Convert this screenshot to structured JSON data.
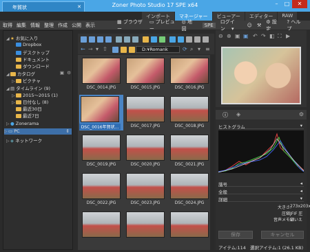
{
  "window": {
    "title": "Zoner Photo Studio 17 SPE x64",
    "doc_tab": "年賀状",
    "min_label": "–",
    "max_label": "□",
    "close_label": "✕"
  },
  "modules": [
    "インポート",
    "マネージャー",
    "ビューアー",
    "エディター",
    "RAW"
  ],
  "menu": [
    "取得",
    "編集",
    "情報",
    "整理",
    "作成",
    "公開",
    "表示"
  ],
  "menu_right": {
    "browser": "ブラウザー",
    "preview": "プレビュー",
    "map": "地図",
    "spe": "SPE",
    "login": "ログイン",
    "settings": "設定",
    "help": "ヘルプ"
  },
  "tree": {
    "favorites": "お気に入り",
    "dropbox": "Dropbox",
    "desktop": "デスクトップ",
    "documents": "ドキュメント",
    "downloads": "ダウンロード",
    "catalog": "カタログ",
    "pictures": "ピクチャ",
    "timeline": "タイムライン (9)",
    "t1": "2015～2015 (1)",
    "t2": "日付なし (8)",
    "t3": "最近30日",
    "t4": "最近7日",
    "zonerama": "Zonerama",
    "pc": "PC",
    "network": "ネットワーク"
  },
  "path": "D:¥Romank",
  "thumbs": [
    {
      "cap": "DSC_0014.JPG"
    },
    {
      "cap": "DSC_0015.JPG"
    },
    {
      "cap": "DSC_0016.JPG"
    },
    {
      "cap": "DSC_0016年賀状..."
    },
    {
      "cap": "DSC_0017.JPG"
    },
    {
      "cap": "DSC_0018.JPG"
    },
    {
      "cap": "DSC_0019.JPG"
    },
    {
      "cap": "DSC_0020.JPG"
    },
    {
      "cap": "DSC_0021.JPG"
    },
    {
      "cap": "DSC_0022.JPG"
    },
    {
      "cap": "DSC_0023.JPG"
    },
    {
      "cap": "DSC_0024.JPG"
    },
    {
      "cap": ""
    },
    {
      "cap": ""
    },
    {
      "cap": ""
    }
  ],
  "info": {
    "histogram": "ヒストグラム",
    "tone": "諧号",
    "general": "全般",
    "detail": "詳細",
    "size_label": "大きさ:",
    "size_value": "273x203x24",
    "compress_label": "圧縮:",
    "compress_value": "JFIF 圧縮",
    "voice_label": "音声メモ:",
    "voice_value": "いいえ",
    "save": "保存",
    "cancel": "キャンセル"
  },
  "status": {
    "items": "アイテム:114",
    "selected": "選択アイテム:1 (26.1 KB)"
  }
}
